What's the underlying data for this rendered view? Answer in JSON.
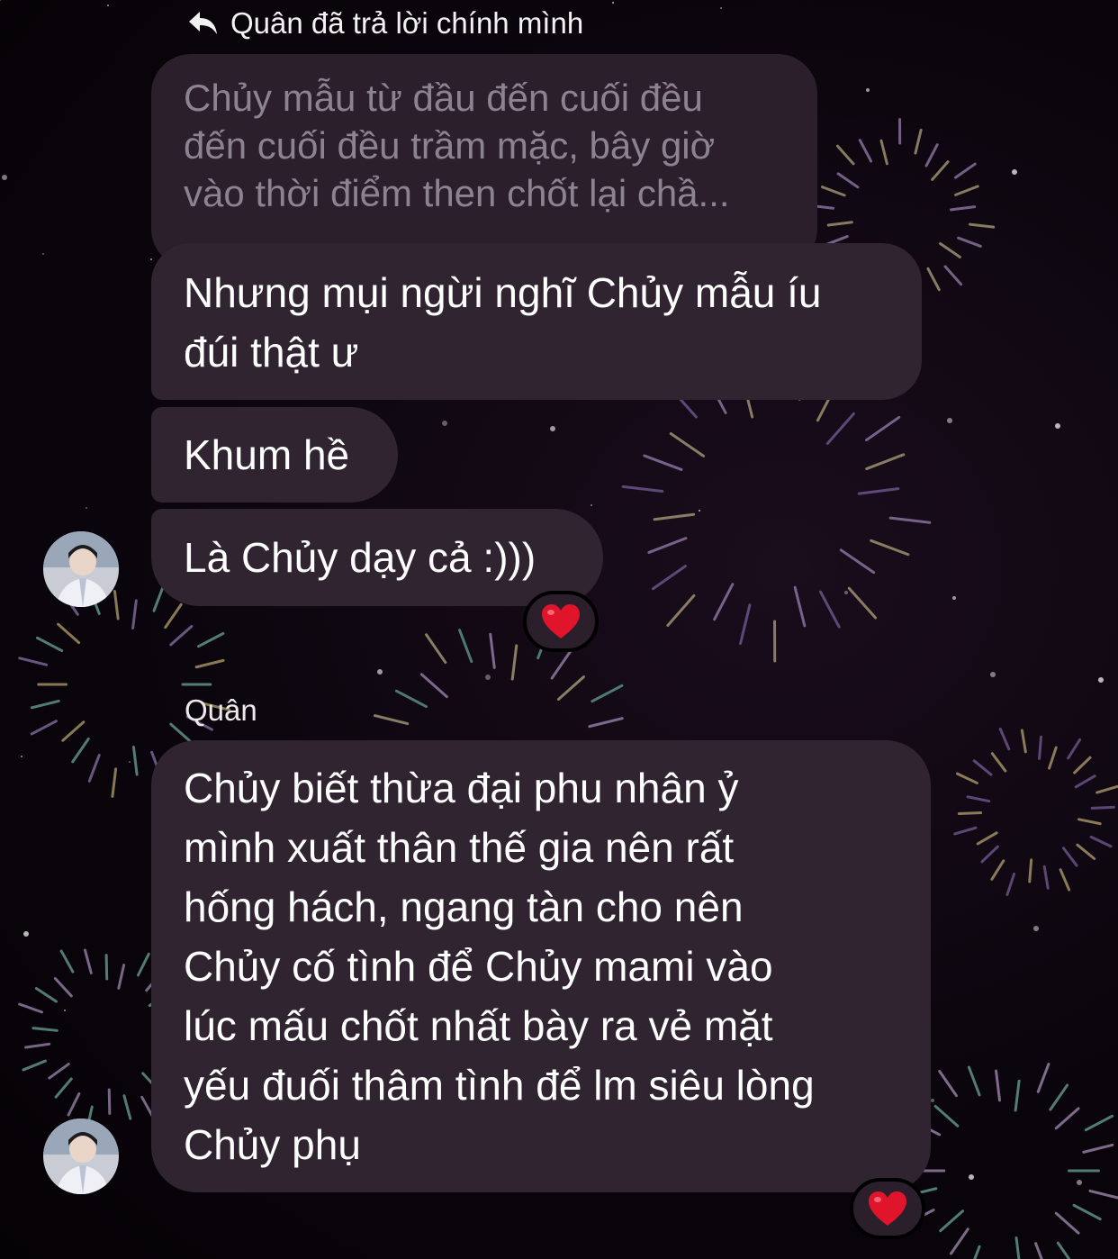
{
  "reply_header": {
    "icon": "reply-arrow-icon",
    "text": "Quân đã trả lời chính mình"
  },
  "messages": [
    {
      "type": "quoted",
      "text": "Chủy mẫu từ đầu đến cuối đều\nđến cuối đều trầm mặc, bây giờ\nvào thời điểm then chốt lại chầ..."
    },
    {
      "type": "incoming",
      "text": "Nhưng mụi ngừi nghĩ Chủy mẫu íu\nđúi thật ư"
    },
    {
      "type": "incoming",
      "text": "Khum hề"
    },
    {
      "type": "incoming",
      "text": "Là Chủy dạy cả :)))",
      "reaction": "heart-icon"
    },
    {
      "type": "incoming",
      "sender": "Quân",
      "text": "Chủy biết thừa đại phu nhân ỷ\nmình xuất thân thế gia nên rất\nhống hách, ngang tàn cho nên\nChủy cố tình để Chủy mami vào\nlúc mấu chốt nhất bày ra vẻ mặt\nyếu đuối thâm tình để lm siêu lòng\nChủy phụ",
      "reaction": "heart-icon"
    }
  ],
  "colors": {
    "bubble": "#2f2430",
    "quoted_bubble": "#2a1f2b",
    "quoted_text": "#8c8390",
    "heart": "#e0142a"
  }
}
